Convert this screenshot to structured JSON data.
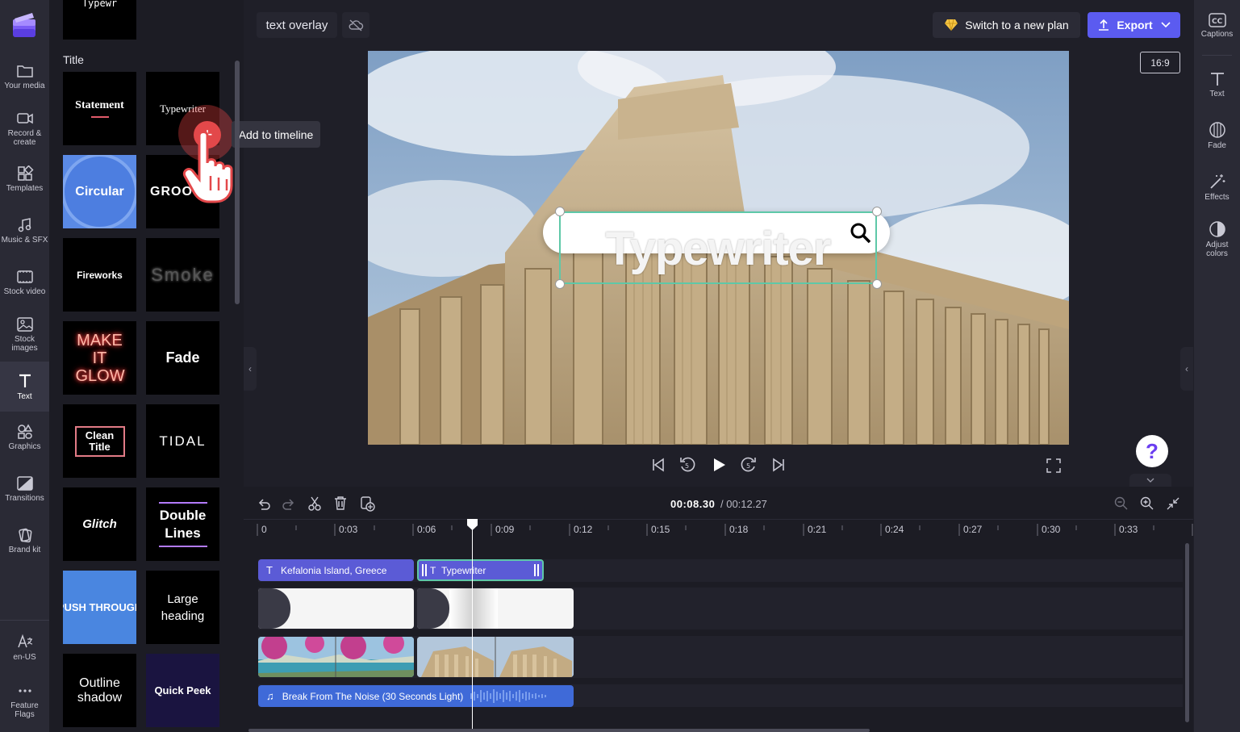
{
  "nav": {
    "items": [
      {
        "label": "Your media",
        "icon": "folder-icon"
      },
      {
        "label": "Record & create",
        "icon": "camera-icon"
      },
      {
        "label": "Templates",
        "icon": "templates-icon"
      },
      {
        "label": "Music & SFX",
        "icon": "music-note-icon"
      },
      {
        "label": "Stock video",
        "icon": "film-icon"
      },
      {
        "label": "Stock images",
        "icon": "image-icon"
      },
      {
        "label": "Text",
        "icon": "text-t-icon"
      },
      {
        "label": "Graphics",
        "icon": "shapes-icon"
      },
      {
        "label": "Transitions",
        "icon": "transitions-icon"
      },
      {
        "label": "Brand kit",
        "icon": "brand-kit-icon"
      }
    ],
    "language": "en-US",
    "feature_flags": "Feature Flags"
  },
  "panel": {
    "top_tile": "Typewr",
    "section_title": "Title",
    "tiles": {
      "statement": "Statement",
      "typewriter": "Typewriter",
      "circular": "Circular",
      "groovy": "GROOVY",
      "fireworks": "Fireworks",
      "smoke": "Smoke",
      "make_it_glow": "MAKE IT GLOW",
      "fade": "Fade",
      "clean_title": "Clean Title",
      "tidal": "TIDAL",
      "glitch": "Glitch",
      "double_lines": "Double Lines",
      "push_through": "PUSH THROUGH",
      "large_heading": "Large heading",
      "outline_shadow": "Outline shadow",
      "quick_peek": "Quick Peek"
    },
    "tooltip": "Add to timeline"
  },
  "topbar": {
    "project_name": "text overlay",
    "switch_plan": "Switch to a new plan",
    "export": "Export",
    "aspect_ratio": "16:9"
  },
  "preview": {
    "overlay_text": "Typewriter"
  },
  "playback": {
    "current_time": "00:08.30",
    "total_time": "/ 00:12.27"
  },
  "timeline": {
    "ruler": [
      "0",
      "0:03",
      "0:06",
      "0:09",
      "0:12",
      "0:15",
      "0:18",
      "0:21",
      "0:24",
      "0:27",
      "0:30",
      "0:33"
    ],
    "text_clips": [
      "Kefalonia Island, Greece",
      "Typewriter"
    ],
    "audio_clip": "Break From The Noise (30 Seconds Light)"
  },
  "rightnav": {
    "items": [
      {
        "label": "Captions",
        "icon": "captions-icon"
      },
      {
        "label": "Text",
        "icon": "text-t-icon"
      },
      {
        "label": "Fade",
        "icon": "fade-icon"
      },
      {
        "label": "Effects",
        "icon": "magic-wand-icon"
      },
      {
        "label": "Adjust colors",
        "icon": "contrast-icon"
      }
    ]
  },
  "colors": {
    "accent": "#5b5bf0",
    "text_clip": "#5b5bd6",
    "audio_clip": "#3f6ad8",
    "selection": "#5ec8a8"
  }
}
